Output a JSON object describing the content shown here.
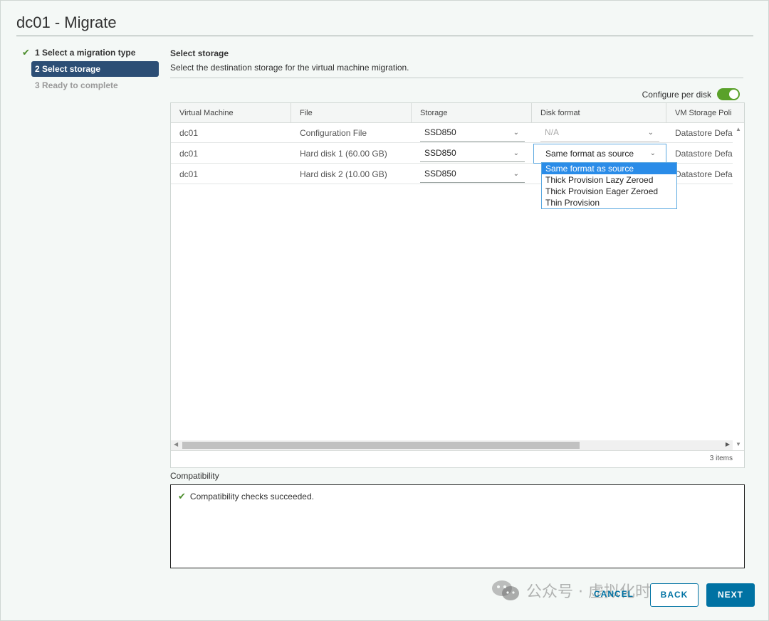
{
  "window": {
    "title": "dc01 - Migrate"
  },
  "steps": [
    {
      "label": "1 Select a migration type",
      "state": "done"
    },
    {
      "label": "2 Select storage",
      "state": "active"
    },
    {
      "label": "3 Ready to complete",
      "state": "pending"
    }
  ],
  "section": {
    "title": "Select storage",
    "description": "Select the destination storage for the virtual machine migration."
  },
  "toggle": {
    "label": "Configure per disk",
    "on": true
  },
  "grid": {
    "columns": [
      "Virtual Machine",
      "File",
      "Storage",
      "Disk format",
      "VM Storage Poli"
    ],
    "rows": [
      {
        "vm": "dc01",
        "file": "Configuration File",
        "storage": "SSD850",
        "disk_format": "N/A",
        "policy": "Datastore Defa"
      },
      {
        "vm": "dc01",
        "file": "Hard disk 1 (60.00 GB)",
        "storage": "SSD850",
        "disk_format": "Same format as source",
        "policy": "Datastore Defa"
      },
      {
        "vm": "dc01",
        "file": "Hard disk 2 (10.00 GB)",
        "storage": "SSD850",
        "disk_format": "",
        "policy": "Datastore Defa"
      }
    ],
    "item_count": "3 items"
  },
  "dropdown": {
    "options": [
      "Same format as source",
      "Thick Provision Lazy Zeroed",
      "Thick Provision Eager Zeroed",
      "Thin Provision"
    ],
    "selected_index": 0
  },
  "compatibility": {
    "label": "Compatibility",
    "message": "Compatibility checks succeeded."
  },
  "buttons": {
    "cancel": "CANCEL",
    "back": "BACK",
    "next": "NEXT"
  },
  "watermark": {
    "text": "公众号 · 虚拟化时代君"
  },
  "colors": {
    "accent": "#0072a3",
    "active_step": "#2c4e75",
    "toggle_on": "#5aa12a",
    "dropdown_highlight": "#2a8ce8",
    "success": "#4a8c2a"
  }
}
